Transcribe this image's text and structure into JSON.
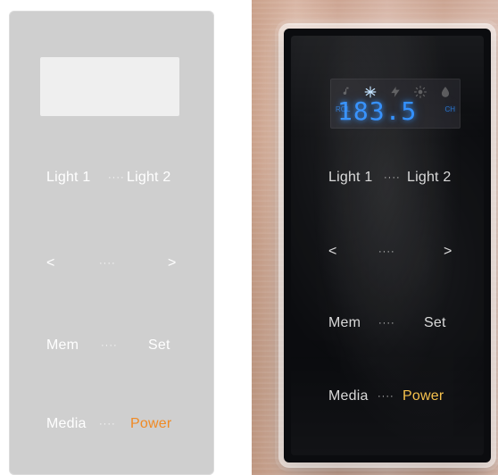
{
  "left_panel": {
    "bg_color": "#cfcfcf",
    "text_color": "#ffffff",
    "power_color": "#f08a24",
    "rows": {
      "light": {
        "left": "Light 1",
        "dots": "····",
        "right": "Light 2"
      },
      "nav": {
        "left": "<",
        "dots": "····",
        "right": ">"
      },
      "mem": {
        "left": "Mem",
        "dots": "····",
        "right": "Set"
      },
      "media": {
        "left": "Media",
        "dots": "····",
        "right": "Power"
      }
    }
  },
  "right_panel": {
    "display": {
      "icons": [
        "music-note-icon",
        "snowflake-icon",
        "bolt-icon",
        "sun-icon",
        "drop-icon"
      ],
      "left_small": "ROL",
      "main": "183.5",
      "right_small": "CH"
    },
    "text_color": "#d9d9d9",
    "power_color": "#f6c14a",
    "rows": {
      "light": {
        "left": "Light 1",
        "dots": "····",
        "right": "Light 2"
      },
      "nav": {
        "left": "<",
        "dots": "····",
        "right": ">"
      },
      "mem": {
        "left": "Mem",
        "dots": "····",
        "right": "Set"
      },
      "media": {
        "left": "Media",
        "dots": "····",
        "right": "Power"
      }
    }
  }
}
